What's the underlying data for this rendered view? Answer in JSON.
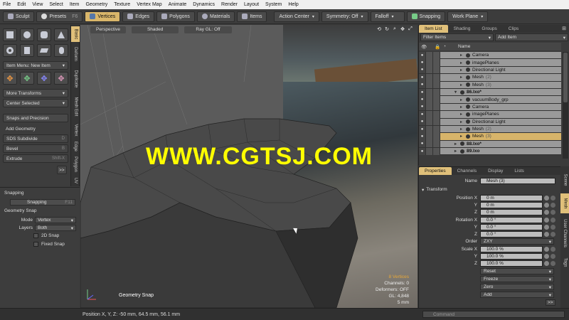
{
  "menubar": [
    "File",
    "Edit",
    "View",
    "Select",
    "Item",
    "Geometry",
    "Texture",
    "Vertex Map",
    "Animate",
    "Dynamics",
    "Render",
    "Layout",
    "System",
    "Help"
  ],
  "toolbar": {
    "sculpt": "Sculpt",
    "presets": "Presets",
    "presets_key": "F6",
    "vertices": "Vertices",
    "edges": "Edges",
    "polygons": "Polygons",
    "materials": "Materials",
    "items": "Items",
    "action_center": "Action Center",
    "symmetry": "Symmetry: Off",
    "falloff": "Falloff",
    "snapping": "Snapping",
    "work_plane": "Work Plane"
  },
  "left_tabs": [
    "Basic",
    "Deform",
    "Duplicate",
    "Mesh Edit",
    "Vertex",
    "Edge",
    "Polygon",
    "UV"
  ],
  "left_panel": {
    "item_menu": "Item Menu: New Item",
    "more_transforms": "More Transforms",
    "center_selected": "Center Selected",
    "snaps_precision": "Snaps and Precision",
    "add_geometry": "Add Geometry",
    "sds_subdivide": "SDS Subdivide",
    "sds_key": "D",
    "bevel": "Bevel",
    "bevel_key": "B",
    "extrude": "Extrude",
    "extrude_key": "Shift-X",
    "more": ">>"
  },
  "snap_panel": {
    "title": "Snapping",
    "snapping_btn": "Snapping",
    "snapping_key": "F11",
    "geometry_snap": "Geometry Snap",
    "mode_label": "Mode",
    "mode_value": "Vertex",
    "layers_label": "Layers",
    "layers_value": "Both",
    "snap_2d": "2D Snap",
    "fixed_snap": "Fixed Snap"
  },
  "viewport": {
    "perspective": "Perspective",
    "shaded": "Shaded",
    "raygl": "Ray GL: Off",
    "label": "Geometry Snap",
    "stats": [
      "8 Vertices",
      "Channels: 0",
      "Deformers: OFF",
      "GL: 4,848",
      "5 mm"
    ],
    "watermark": "WWW.CGTSJ.COM"
  },
  "statusbar": {
    "position": "Position X, Y, Z:  -50 mm, 64.5 mm, 56.1 mm",
    "command_placeholder": "Command"
  },
  "item_list": {
    "tabs": [
      "Item List",
      "Shading",
      "Groups",
      "Clips"
    ],
    "filter": "Filter Items",
    "add_item": "Add Item",
    "name_header": "Name",
    "rows": [
      {
        "label": "Camera",
        "suffix": "",
        "indent": 3
      },
      {
        "label": "imagePlanes",
        "suffix": "",
        "indent": 3
      },
      {
        "label": "Directional Light",
        "suffix": "",
        "indent": 3
      },
      {
        "label": "Mesh",
        "suffix": "(2)",
        "indent": 3
      },
      {
        "label": "Mesh",
        "suffix": "(3)",
        "indent": 3
      },
      {
        "label": "86.lxo*",
        "suffix": "",
        "indent": 1,
        "group": true
      },
      {
        "label": "vacuumBody_grp",
        "suffix": "",
        "indent": 3
      },
      {
        "label": "Camera",
        "suffix": "",
        "indent": 3
      },
      {
        "label": "imagePlanes",
        "suffix": "",
        "indent": 3
      },
      {
        "label": "Directional Light",
        "suffix": "",
        "indent": 3
      },
      {
        "label": "Mesh",
        "suffix": "(2)",
        "indent": 3
      },
      {
        "label": "Mesh",
        "suffix": "(3)",
        "indent": 3,
        "selected": true
      },
      {
        "label": "88.lxo*",
        "suffix": "",
        "indent": 1,
        "group": true
      },
      {
        "label": "89.lxo",
        "suffix": "",
        "indent": 1,
        "group": true
      }
    ]
  },
  "properties": {
    "tabs": [
      "Properties",
      "Channels",
      "Display",
      "Lists"
    ],
    "name_label": "Name",
    "name_value": "Mesh (3)",
    "transform": "Transform",
    "position_label": "Position X",
    "position": [
      "0 m",
      "0 m",
      "0 m"
    ],
    "rotation_label": "Rotation X",
    "rotation": [
      "0.0 °",
      "0.0 °",
      "0.0 °"
    ],
    "order_label": "Order",
    "order_value": "ZXY",
    "scale_label": "Scale X",
    "scale": [
      "100.0 %",
      "100.0 %",
      "100.0 %"
    ],
    "axis_y": "Y",
    "axis_z": "Z",
    "buttons": [
      "Reset",
      "Freeze",
      "Zero",
      "Add"
    ],
    "more": ">>"
  },
  "right_vtabs": [
    "Scene",
    "Mesh",
    "User Channels",
    "Tags"
  ],
  "colors": {
    "accent": "#d9b66a",
    "watermark": "#ffff00",
    "selected_row": "#d7b46a"
  }
}
